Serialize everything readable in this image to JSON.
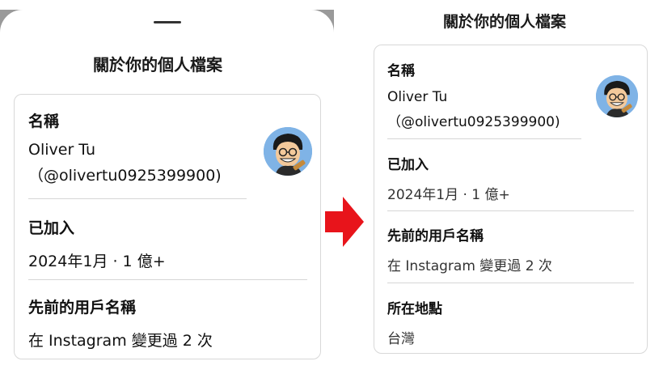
{
  "left": {
    "title": "關於你的個人檔案",
    "name_label": "名稱",
    "name_value": "Oliver Tu",
    "handle_value": "（@olivertu0925399900)",
    "joined_label": "已加入",
    "joined_value": "2024年1月 · 1 億+",
    "prev_label": "先前的用戶名稱",
    "prev_value": "在 Instagram 變更過 2 次"
  },
  "right": {
    "title": "關於你的個人檔案",
    "name_label": "名稱",
    "name_value": "Oliver Tu",
    "handle_value": "（@olivertu0925399900)",
    "joined_label": "已加入",
    "joined_value": "2024年1月 · 1 億+",
    "prev_label": "先前的用戶名稱",
    "prev_value": "在 Instagram 變更過 2 次",
    "location_label": "所在地點",
    "location_value": "台灣"
  },
  "colors": {
    "arrow": "#e8141b",
    "avatar_bg": "#7fb3e6"
  },
  "icons": {
    "avatar": "cartoon-avatar-icon",
    "arrow": "right-arrow-icon"
  }
}
